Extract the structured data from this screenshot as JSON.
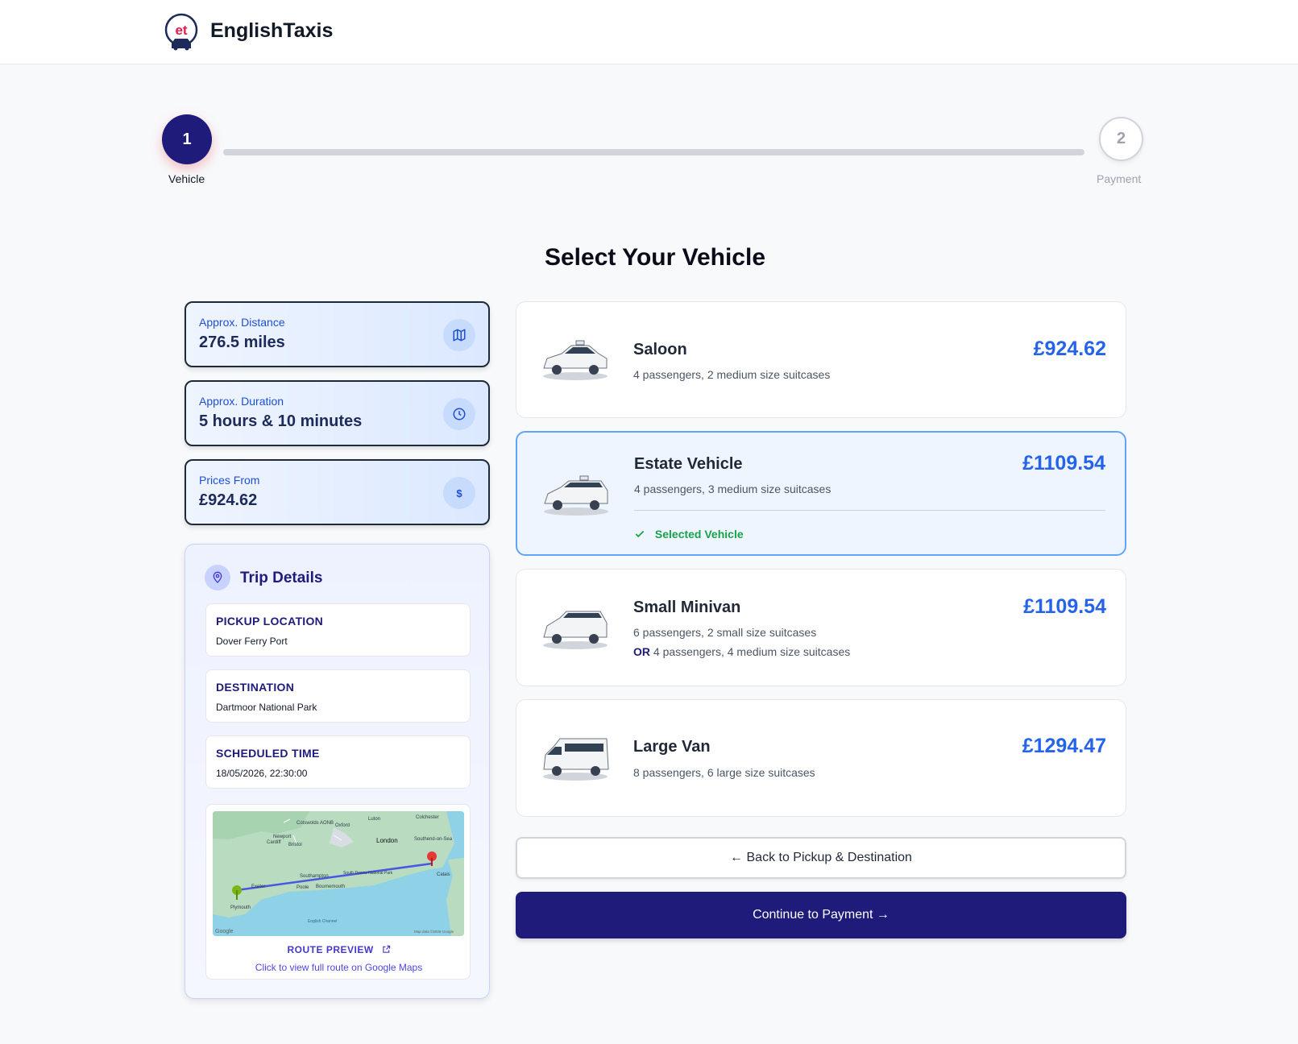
{
  "header": {
    "brand": "EnglishTaxis",
    "logo_text": "et"
  },
  "stepper": {
    "steps": [
      {
        "number": "1",
        "label": "Vehicle"
      },
      {
        "number": "2",
        "label": "Payment"
      }
    ],
    "progress": 0
  },
  "page_title": "Select Your Vehicle",
  "info_cards": [
    {
      "label": "Approx. Distance",
      "value": "276.5 miles",
      "icon": "map-icon"
    },
    {
      "label": "Approx. Duration",
      "value": "5 hours & 10 minutes",
      "icon": "clock-icon"
    },
    {
      "label": "Prices From",
      "value": "£924.62",
      "icon": "dollar-icon",
      "icon_text": "$"
    }
  ],
  "trip": {
    "title": "Trip Details",
    "pickup_label": "PICKUP LOCATION",
    "pickup_value": "Dover Ferry Port",
    "destination_label": "DESTINATION",
    "destination_value": "Dartmoor National Park",
    "time_label": "SCHEDULED TIME",
    "time_value": "18/05/2026, 22:30:00",
    "route_label": "ROUTE PREVIEW",
    "route_sub": "Click to view full route on Google Maps",
    "map_labels": {
      "london": "London",
      "oxford": "Oxford",
      "luton": "Luton",
      "colchester": "Colchester",
      "southend": "Southend-on-Sea",
      "newport": "Newport",
      "cardiff": "Cardiff",
      "bristol": "Bristol",
      "cotswolds": "Cotswolds AONB",
      "southampton": "Southampton",
      "bournemouth": "Bournemouth",
      "poole": "Poole",
      "exeter": "Exeter",
      "plymouth": "Plymouth",
      "calais": "Calais",
      "south_downs": "South Downs National Park",
      "channel": "English Channel",
      "google": "Google",
      "map_data": "Map data ©2026 Google"
    }
  },
  "vehicles": [
    {
      "name": "Saloon",
      "desc": "4 passengers, 2 medium size suitcases",
      "price": "£924.62",
      "selected": false
    },
    {
      "name": "Estate Vehicle",
      "desc": "4 passengers, 3 medium size suitcases",
      "price": "£1109.54",
      "selected": true,
      "selected_text": "Selected Vehicle"
    },
    {
      "name": "Small Minivan",
      "desc": "6 passengers, 2 small size suitcases",
      "desc_or": "OR",
      "desc_alt": "4 passengers, 4 medium size suitcases",
      "price": "£1109.54",
      "selected": false
    },
    {
      "name": "Large Van",
      "desc": "8 passengers, 6 large size suitcases",
      "price": "£1294.47",
      "selected": false
    }
  ],
  "buttons": {
    "back": "← Back to Pickup & Destination",
    "continue": "Continue to Payment →"
  },
  "colors": {
    "navy": "#1e1b7b",
    "accent_blue": "#2563eb",
    "success": "#16a34a",
    "logo_red": "#e11d48"
  }
}
